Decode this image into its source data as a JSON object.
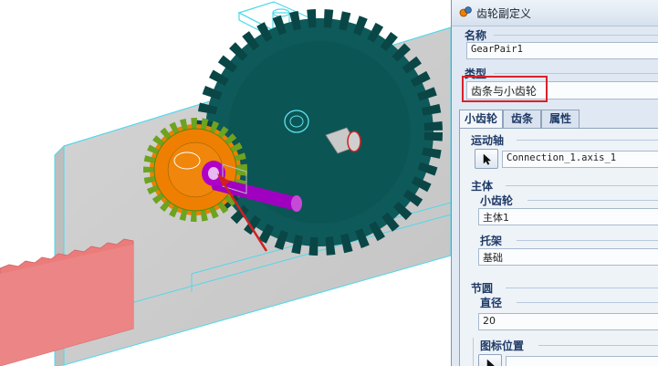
{
  "dialog": {
    "title": "齿轮副定义",
    "name_label": "名称",
    "name_value": "GearPair1",
    "type_label": "类型",
    "type_value": "齿条与小齿轮",
    "tabs": [
      {
        "label": "小齿轮",
        "active": true
      },
      {
        "label": "齿条",
        "active": false
      },
      {
        "label": "属性",
        "active": false
      }
    ],
    "motion_axis": {
      "label": "运动轴",
      "value": "Connection_1.axis_1"
    },
    "body": {
      "label": "主体",
      "pinion_label": "小齿轮",
      "pinion_value": "主体1",
      "carrier_label": "托架",
      "carrier_value": "基础"
    },
    "pitch_circle": {
      "label": "节圆",
      "diameter_label": "直径",
      "diameter_value": "20"
    },
    "icon_position": {
      "label": "图标位置"
    }
  },
  "viewport": {
    "scene": "3D rack-and-pinion gear assembly",
    "colors": {
      "big_gear": "#0e5a5a",
      "small_gear": "#ef7f00",
      "small_gear_edges": "#6da31f",
      "shaft": "#b000c8",
      "rack": "#ec7c7c",
      "housing": "#d7d7d7",
      "highlight_edges": "#40e0f0",
      "annotation_arrow": "#d22020"
    }
  }
}
